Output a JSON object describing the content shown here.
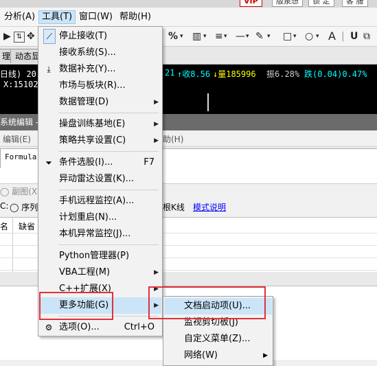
{
  "top": {
    "btn_vip": "VIP",
    "btn_version": "版泉想",
    "btn_lock": "锁 定",
    "btn_guest": "客 服"
  },
  "menubar": {
    "analysis": "分析(A)",
    "tools": "工具(T)",
    "window": "窗口(W)",
    "help": "帮助(H)"
  },
  "toolbar": {
    "percent": "%",
    "letter_a": "A"
  },
  "tabs": {
    "tab1": "理",
    "tab2": "动态显"
  },
  "chart": {
    "line1_left": "日线) 20",
    "line1_right_prefix": "21",
    "close_label": "收8.56",
    "volume_label": "量185996",
    "amplitude": "振6.28%",
    "fall": "跌(0.04)0.47%",
    "line2": "X:15102"
  },
  "editor": {
    "title": "系统编辑 - (",
    "menu_edit": "编辑(E)",
    "menu_help": "助(H)"
  },
  "formula": {
    "text": "Formula"
  },
  "options": {
    "subchart": "副图(X)",
    "c_label": "C:",
    "seq": "序列",
    "kline": "根K线",
    "mode_link": "模式说明"
  },
  "grid": {
    "col_name": "名",
    "col_default": "缺省"
  },
  "menu": {
    "items": [
      {
        "label": "停止接收(T)",
        "icon": "plug-icon"
      },
      {
        "label": "接收系统(S)..."
      },
      {
        "label": "数据补充(Y)...",
        "icon": "download-icon"
      },
      {
        "label": "市场与板块(R)..."
      },
      {
        "label": "数据管理(D)",
        "submenu": true
      },
      {
        "label": "操盘训练基地(E)",
        "submenu": true
      },
      {
        "label": "策略共享设置(C)",
        "submenu": true
      },
      {
        "label": "条件选股(I)...",
        "shortcut": "F7",
        "icon": "filter-icon"
      },
      {
        "label": "异动雷达设置(K)..."
      },
      {
        "label": "手机远程监控(A)..."
      },
      {
        "label": "计划重启(N)..."
      },
      {
        "label": "本机异常监控(J)..."
      },
      {
        "label": "Python管理器(P)"
      },
      {
        "label": "VBA工程(M)",
        "submenu": true
      },
      {
        "label": "C++扩展(X)",
        "submenu": true
      },
      {
        "label": "更多功能(G)",
        "submenu": true
      },
      {
        "label": "选项(O)...",
        "shortcut": "Ctrl+O",
        "icon": "gear-icon"
      }
    ]
  },
  "submenu": {
    "items": [
      {
        "label": "文档启动项(U)..."
      },
      {
        "label": "监视剪切板(J)"
      },
      {
        "label": "自定义菜单(Z)..."
      },
      {
        "label": "网络(W)",
        "submenu": true
      }
    ]
  },
  "colors": {
    "highlight": "#cce4f7",
    "annotation": "#e0303a",
    "chart_bg": "#000000",
    "chart_cyan": "#00ffff",
    "chart_yellow": "#ffff00"
  }
}
